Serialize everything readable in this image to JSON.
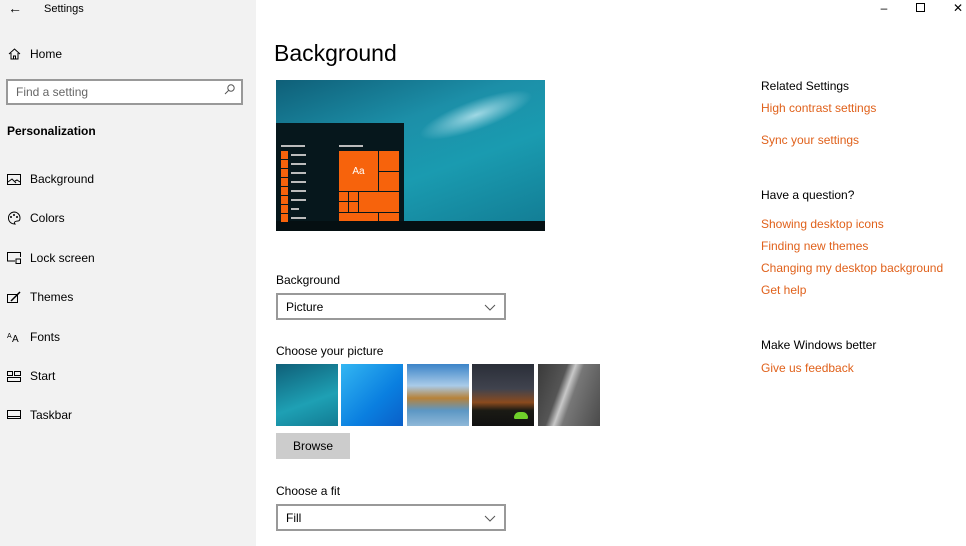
{
  "window": {
    "title": "Settings",
    "controls": [
      "minimize",
      "maximize",
      "close"
    ]
  },
  "sidebar": {
    "home": "Home",
    "search_placeholder": "Find a setting",
    "section": "Personalization",
    "items": [
      {
        "label": "Background",
        "icon": "picture-icon"
      },
      {
        "label": "Colors",
        "icon": "palette-icon"
      },
      {
        "label": "Lock screen",
        "icon": "lock-screen-icon"
      },
      {
        "label": "Themes",
        "icon": "themes-icon"
      },
      {
        "label": "Fonts",
        "icon": "fonts-icon"
      },
      {
        "label": "Start",
        "icon": "start-icon"
      },
      {
        "label": "Taskbar",
        "icon": "taskbar-icon"
      }
    ]
  },
  "main": {
    "title": "Background",
    "preview_tile_text": "Aa",
    "background_label": "Background",
    "background_value": "Picture",
    "choose_picture_label": "Choose your picture",
    "browse": "Browse",
    "fit_label": "Choose a fit",
    "fit_value": "Fill"
  },
  "related": {
    "heading": "Related Settings",
    "links": [
      "High contrast settings",
      "Sync your settings"
    ]
  },
  "question": {
    "heading": "Have a question?",
    "links": [
      "Showing desktop icons",
      "Finding new themes",
      "Changing my desktop background",
      "Get help"
    ]
  },
  "better": {
    "heading": "Make Windows better",
    "link": "Give us feedback"
  },
  "colors": {
    "accent": "#f7630c",
    "link": "#e0611b",
    "sidebar": "#f2f2f2"
  }
}
